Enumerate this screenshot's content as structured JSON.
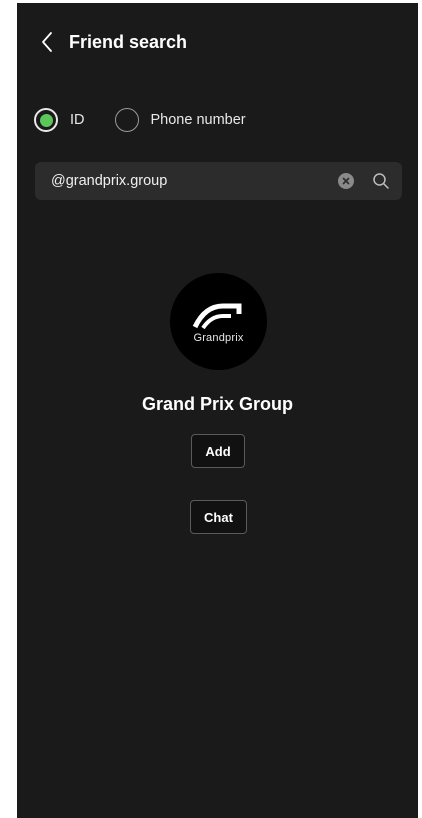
{
  "header": {
    "title": "Friend search"
  },
  "search_type": {
    "options": [
      {
        "label": "ID",
        "selected": true
      },
      {
        "label": "Phone number",
        "selected": false
      }
    ]
  },
  "search": {
    "value": "@grandprix.group"
  },
  "result": {
    "logo_text": "Grandprix",
    "name": "Grand Prix Group",
    "add_label": "Add",
    "chat_label": "Chat"
  },
  "colors": {
    "background": "#1a1a1a",
    "accent_green": "#5cc65a",
    "search_bg": "#2c2c2c"
  }
}
